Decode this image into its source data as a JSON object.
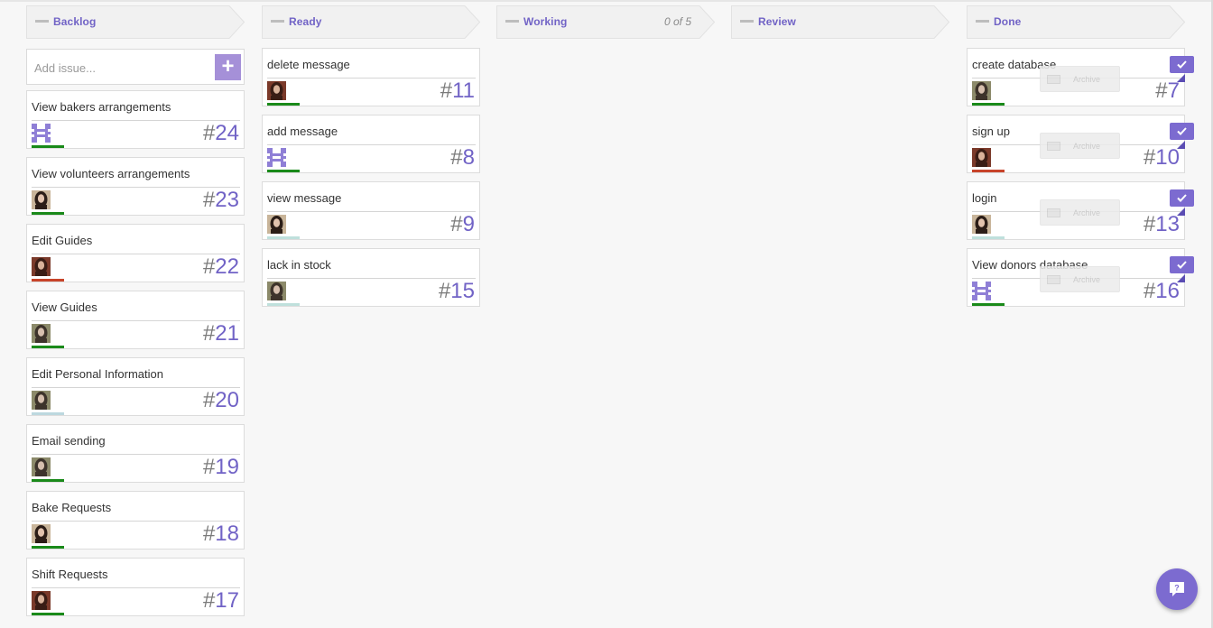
{
  "columns": [
    {
      "id": "backlog",
      "title": "Backlog",
      "wip": "",
      "add_issue_placeholder": "Add issue...",
      "add_button_label": "+",
      "cards": [
        {
          "title": "View bakers arrangements",
          "number": "24",
          "avatar": "identicon",
          "bar_color": "#1a8a1a"
        },
        {
          "title": "View volunteers arrangements",
          "number": "23",
          "avatar": "photo-a",
          "bar_color": "#1a8a1a"
        },
        {
          "title": "Edit Guides",
          "number": "22",
          "avatar": "photo-b",
          "bar_color": "#c8442a"
        },
        {
          "title": "View Guides",
          "number": "21",
          "avatar": "photo-c",
          "bar_color": "#1a8a1a"
        },
        {
          "title": "Edit Personal Information",
          "number": "20",
          "avatar": "photo-c",
          "bar_color": "#bcd8df"
        },
        {
          "title": "Email sending",
          "number": "19",
          "avatar": "photo-c",
          "bar_color": "#1a8a1a"
        },
        {
          "title": "Bake Requests",
          "number": "18",
          "avatar": "photo-a",
          "bar_color": "#1a8a1a"
        },
        {
          "title": "Shift Requests",
          "number": "17",
          "avatar": "photo-b",
          "bar_color": "#1a8a1a"
        }
      ]
    },
    {
      "id": "ready",
      "title": "Ready",
      "wip": "",
      "cards": [
        {
          "title": "delete message",
          "number": "11",
          "avatar": "photo-b",
          "bar_color": "#1a8a1a"
        },
        {
          "title": "add message",
          "number": "8",
          "avatar": "identicon",
          "bar_color": "#1a8a1a"
        },
        {
          "title": "view message",
          "number": "9",
          "avatar": "photo-a",
          "bar_color": "#bfe0dc"
        },
        {
          "title": "lack in stock",
          "number": "15",
          "avatar": "photo-c",
          "bar_color": "#bfe0dc"
        }
      ]
    },
    {
      "id": "working",
      "title": "Working",
      "wip": "0 of 5",
      "cards": []
    },
    {
      "id": "review",
      "title": "Review",
      "wip": "",
      "cards": []
    },
    {
      "id": "done",
      "title": "Done",
      "wip": "",
      "archive_label": "Archive",
      "cards": [
        {
          "title": "create database",
          "number": "7",
          "avatar": "photo-c",
          "bar_color": "#1a8a1a"
        },
        {
          "title": "sign up",
          "number": "10",
          "avatar": "photo-b",
          "bar_color": "#c8442a"
        },
        {
          "title": "login",
          "number": "13",
          "avatar": "photo-a",
          "bar_color": "#bfe0dc"
        },
        {
          "title": "View donors database",
          "number": "16",
          "avatar": "identicon",
          "bar_color": "#1a8a1a"
        }
      ]
    }
  ],
  "help_button": {
    "icon": "chat-question-icon"
  },
  "colors": {
    "accent": "#7163c6",
    "header_bg": "#f2f2f2"
  }
}
